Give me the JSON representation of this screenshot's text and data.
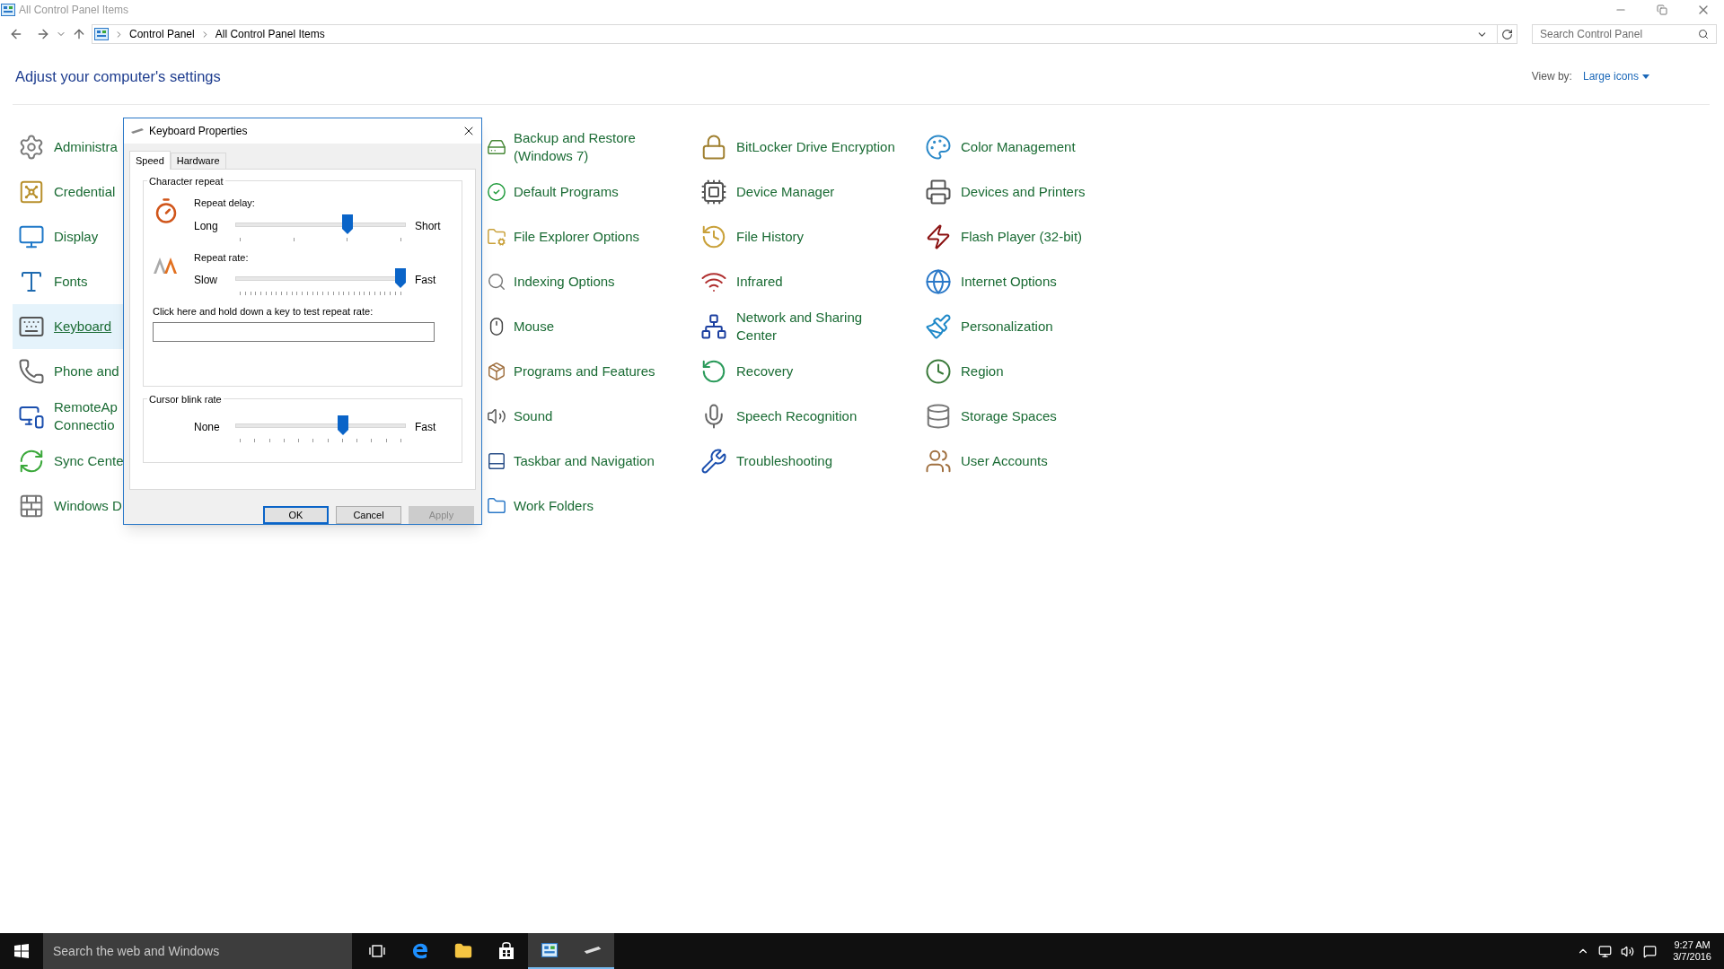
{
  "window": {
    "title": "All Control Panel Items"
  },
  "address_bar": {
    "path": [
      "Control Panel",
      "All Control Panel Items"
    ]
  },
  "search": {
    "placeholder": "Search Control Panel"
  },
  "heading": "Adjust your computer's settings",
  "view_by": {
    "label": "View by:",
    "value": "Large icons"
  },
  "columns": [
    [
      {
        "label": "Administra",
        "selected": false
      },
      {
        "label": "Credential",
        "selected": false
      },
      {
        "label": "Display",
        "selected": false
      },
      {
        "label": "Fonts",
        "selected": false
      },
      {
        "label": "Keyboard",
        "selected": true
      },
      {
        "label": "Phone and",
        "selected": false
      },
      {
        "label": "RemoteAp\nConnectio",
        "selected": false
      },
      {
        "label": "Sync Cente",
        "selected": false
      },
      {
        "label": "Windows D",
        "selected": false
      }
    ],
    [
      {
        "label": "Backup and Restore\n(Windows 7)",
        "selected": false
      },
      {
        "label": "Default Programs",
        "selected": false
      },
      {
        "label": "File Explorer Options",
        "selected": false
      },
      {
        "label": "Indexing Options",
        "selected": false
      },
      {
        "label": "Mouse",
        "selected": false
      },
      {
        "label": "Programs and Features",
        "selected": false
      },
      {
        "label": "Sound",
        "selected": false
      },
      {
        "label": "Taskbar and Navigation",
        "selected": false
      },
      {
        "label": "Work Folders",
        "selected": false
      }
    ],
    [
      {
        "label": "BitLocker Drive Encryption",
        "selected": false
      },
      {
        "label": "Device Manager",
        "selected": false
      },
      {
        "label": "File History",
        "selected": false
      },
      {
        "label": "Infrared",
        "selected": false
      },
      {
        "label": "Network and Sharing\nCenter",
        "selected": false
      },
      {
        "label": "Recovery",
        "selected": false
      },
      {
        "label": "Speech Recognition",
        "selected": false
      },
      {
        "label": "Troubleshooting",
        "selected": false
      }
    ],
    [
      {
        "label": "Color Management",
        "selected": false
      },
      {
        "label": "Devices and Printers",
        "selected": false
      },
      {
        "label": "Flash Player (32-bit)",
        "selected": false
      },
      {
        "label": "Internet Options",
        "selected": false
      },
      {
        "label": "Personalization",
        "selected": false
      },
      {
        "label": "Region",
        "selected": false
      },
      {
        "label": "Storage Spaces",
        "selected": false
      },
      {
        "label": "User Accounts",
        "selected": false
      }
    ]
  ],
  "dialog": {
    "title": "Keyboard Properties",
    "tabs": [
      {
        "label": "Speed",
        "selected": true
      },
      {
        "label": "Hardware",
        "selected": false
      }
    ],
    "character_repeat": {
      "title": "Character repeat",
      "repeat_delay": {
        "label": "Repeat delay:",
        "min_label": "Long",
        "max_label": "Short",
        "level": 0.67
      },
      "repeat_rate": {
        "label": "Repeat rate:",
        "min_label": "Slow",
        "max_label": "Fast",
        "level": 1.0
      },
      "test_label": "Click here and hold down a key to test repeat rate:"
    },
    "cursor_blink": {
      "title": "Cursor blink rate",
      "min_label": "None",
      "max_label": "Fast",
      "level": 0.64
    },
    "buttons": [
      {
        "label": "OK",
        "default": true,
        "disabled": false
      },
      {
        "label": "Cancel",
        "default": false,
        "disabled": false
      },
      {
        "label": "Apply",
        "default": false,
        "disabled": true
      }
    ]
  },
  "taskbar": {
    "search_placeholder": "Search the web and Windows",
    "time": "9:27 AM",
    "date": "3/7/2016"
  }
}
